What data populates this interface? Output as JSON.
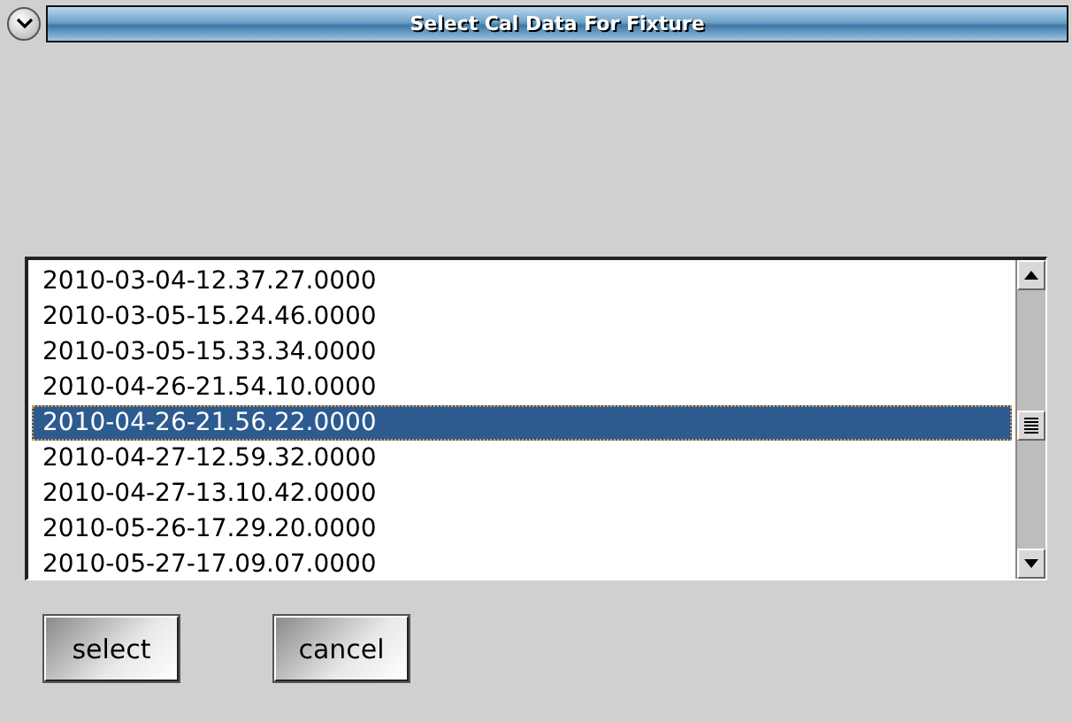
{
  "window": {
    "title": "Select Cal Data For Fixture"
  },
  "list": {
    "items": [
      {
        "label": "2010-03-04-12.37.27.0000",
        "selected": false
      },
      {
        "label": "2010-03-05-15.24.46.0000",
        "selected": false
      },
      {
        "label": "2010-03-05-15.33.34.0000",
        "selected": false
      },
      {
        "label": "2010-04-26-21.54.10.0000",
        "selected": false
      },
      {
        "label": "2010-04-26-21.56.22.0000",
        "selected": true
      },
      {
        "label": "2010-04-27-12.59.32.0000",
        "selected": false
      },
      {
        "label": "2010-04-27-13.10.42.0000",
        "selected": false
      },
      {
        "label": "2010-05-26-17.29.20.0000",
        "selected": false
      },
      {
        "label": "2010-05-27-17.09.07.0000",
        "selected": false
      }
    ]
  },
  "buttons": [
    "select",
    "cancel"
  ]
}
